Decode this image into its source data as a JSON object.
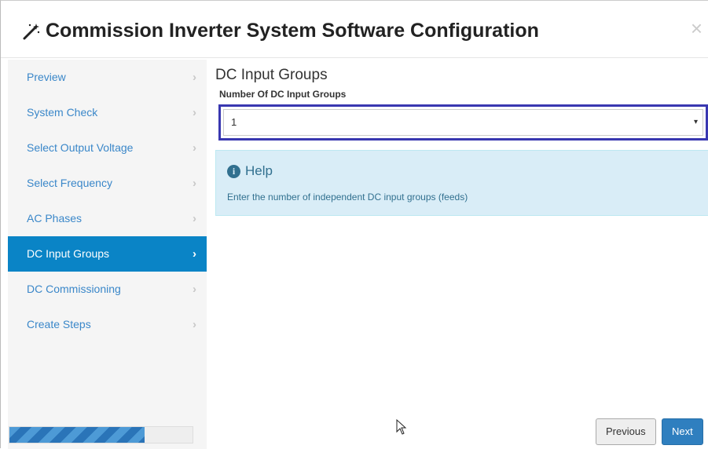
{
  "header": {
    "title": "Commission Inverter System Software Configuration",
    "wand_icon": "magic-wand-icon",
    "close_glyph": "×"
  },
  "sidebar": {
    "items": [
      {
        "label": "Preview",
        "active": false
      },
      {
        "label": "System Check",
        "active": false
      },
      {
        "label": "Select Output Voltage",
        "active": false
      },
      {
        "label": "Select Frequency",
        "active": false
      },
      {
        "label": "AC Phases",
        "active": false
      },
      {
        "label": "DC Input Groups",
        "active": true
      },
      {
        "label": "DC Commissioning",
        "active": false
      },
      {
        "label": "Create Steps",
        "active": false
      }
    ],
    "chevron": "›",
    "progress_fraction": 0.74
  },
  "content": {
    "section_title": "DC Input Groups",
    "field_label": "Number Of DC Input Groups",
    "select_value": "1",
    "select_caret": "▾",
    "help_title": "Help",
    "help_icon": "info-circle-icon",
    "help_text": "Enter the number of independent DC input groups (feeds)"
  },
  "footer": {
    "previous_label": "Previous",
    "next_label": "Next"
  },
  "colors": {
    "active_nav": "#0a84c6",
    "link": "#3a87c9",
    "help_bg": "#d9edf7",
    "highlight_outline": "#3937b0",
    "next_button": "#2f7fbf"
  }
}
